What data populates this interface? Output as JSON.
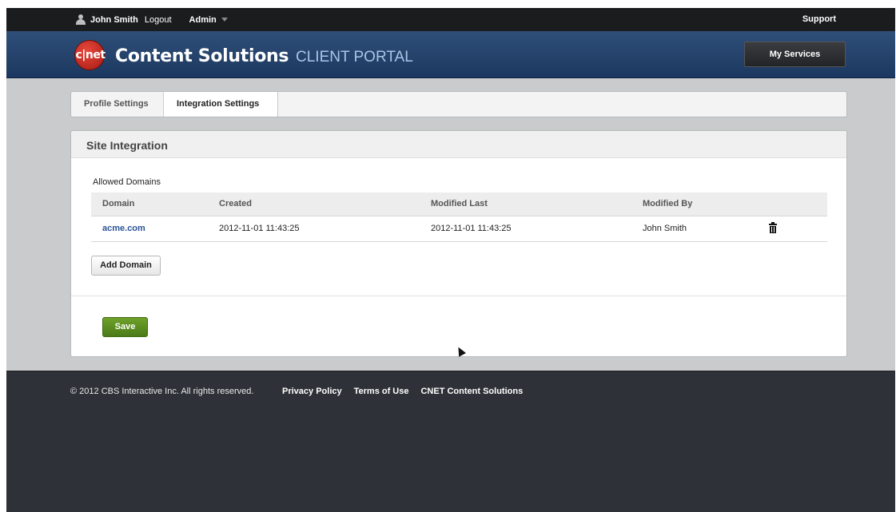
{
  "topbar": {
    "username": "John Smith",
    "logout": "Logout",
    "admin": "Admin",
    "support": "Support"
  },
  "header": {
    "logo_text": "c|net",
    "brand": "Content Solutions",
    "portal": "CLIENT PORTAL",
    "my_services": "My Services"
  },
  "tabs": [
    {
      "label": "Profile Settings",
      "active": false
    },
    {
      "label": "Integration Settings",
      "active": true
    }
  ],
  "panel": {
    "title": "Site Integration",
    "section_label": "Allowed Domains",
    "columns": [
      "Domain",
      "Created",
      "Modified Last",
      "Modified By"
    ],
    "rows": [
      {
        "domain": "acme.com",
        "created": "2012-11-01 11:43:25",
        "modified_last": "2012-11-01 11:43:25",
        "modified_by": "John Smith",
        "delete_icon": "trash-icon"
      }
    ],
    "add_button": "Add Domain",
    "save_button": "Save"
  },
  "footer": {
    "copyright": "© 2012 CBS Interactive Inc. All rights reserved.",
    "links": [
      "Privacy Policy",
      "Terms of Use",
      "CNET Content Solutions"
    ]
  },
  "colors": {
    "header_blue": "#1c3860",
    "save_green": "#4b7c18",
    "link_blue": "#2a5496",
    "footer_bg": "#2e3137"
  }
}
